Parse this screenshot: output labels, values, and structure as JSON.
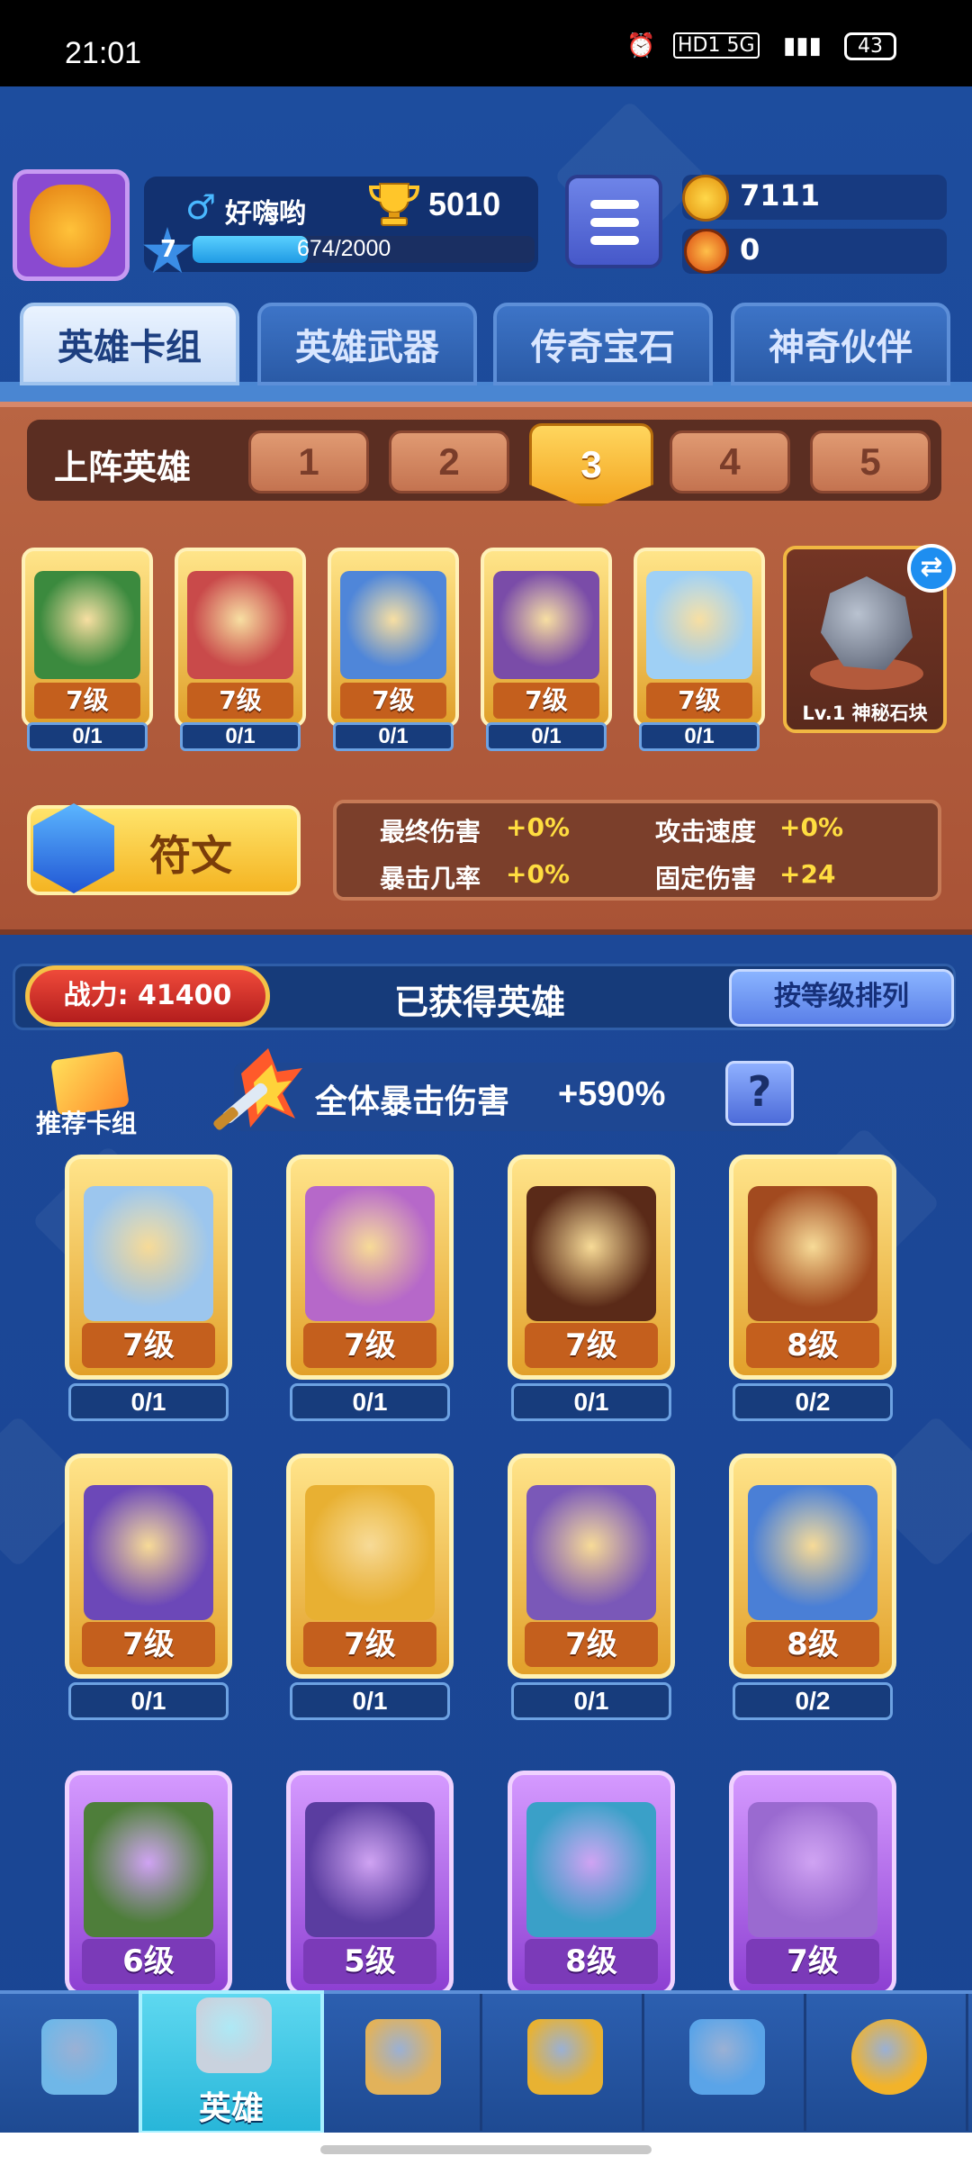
{
  "status_bar": {
    "time": "21:01",
    "network": "HD1 5G",
    "battery": "43"
  },
  "player": {
    "name": "好嗨哟",
    "trophies": "5010",
    "level": "7",
    "xp_text": "674/2000",
    "xp_fraction": 0.337
  },
  "currency": {
    "gold": "7111",
    "fire": "0"
  },
  "tabs": [
    {
      "label": "英雄卡组",
      "active": true
    },
    {
      "label": "英雄武器",
      "active": false
    },
    {
      "label": "传奇宝石",
      "active": false
    },
    {
      "label": "神奇伙伴",
      "active": false
    }
  ],
  "deck": {
    "label": "上阵英雄",
    "slots": [
      "1",
      "2",
      "3",
      "4",
      "5"
    ],
    "selected_slot": "3",
    "heroes": [
      {
        "level": "7级",
        "count": "0/1",
        "color": "#3b8a3e"
      },
      {
        "level": "7级",
        "count": "0/1",
        "color": "#c94a4a"
      },
      {
        "level": "7级",
        "count": "0/1",
        "color": "#4f86d9"
      },
      {
        "level": "7级",
        "count": "0/1",
        "color": "#7a4ca8"
      },
      {
        "level": "7级",
        "count": "0/1",
        "color": "#9fd0f5"
      }
    ],
    "partner": {
      "label": "Lv.1 神秘石块"
    }
  },
  "rune": {
    "label": "符文"
  },
  "stats": [
    {
      "name": "最终伤害",
      "value": "+0%"
    },
    {
      "name": "攻击速度",
      "value": "+0%"
    },
    {
      "name": "暴击几率",
      "value": "+0%"
    },
    {
      "name": "固定伤害",
      "value": "+24"
    }
  ],
  "collection": {
    "power": "战力: 41400",
    "title": "已获得英雄",
    "sort_button": "按等级排列",
    "recommend_label": "推荐卡组",
    "crit_label": "全体暴击伤害",
    "crit_value": "+590%",
    "help": "?"
  },
  "heroes": [
    {
      "level": "7级",
      "count": "0/1",
      "color": "#9cc6ee",
      "tier": "gold"
    },
    {
      "level": "7级",
      "count": "0/1",
      "color": "#b668c9",
      "tier": "gold"
    },
    {
      "level": "7级",
      "count": "0/1",
      "color": "#5a2a18",
      "tier": "gold"
    },
    {
      "level": "8级",
      "count": "0/2",
      "color": "#a24a1f",
      "tier": "gold"
    },
    {
      "level": "7级",
      "count": "0/1",
      "color": "#6c48b8",
      "tier": "gold"
    },
    {
      "level": "7级",
      "count": "0/1",
      "color": "#e8b032",
      "tier": "gold"
    },
    {
      "level": "7级",
      "count": "0/1",
      "color": "#7a58b8",
      "tier": "gold"
    },
    {
      "level": "8级",
      "count": "0/2",
      "color": "#4a7fd6",
      "tier": "gold"
    },
    {
      "level": "6级",
      "count": "",
      "color": "#4e7e3a",
      "tier": "purple"
    },
    {
      "level": "5级",
      "count": "",
      "color": "#5a3da0",
      "tier": "purple"
    },
    {
      "level": "8级",
      "count": "",
      "color": "#3aa0c8",
      "tier": "purple"
    },
    {
      "level": "7级",
      "count": "",
      "color": "#9a6ad0",
      "tier": "purple"
    }
  ],
  "nav": [
    {
      "icon": "treasure-chest-icon",
      "label": ""
    },
    {
      "icon": "knight-helmet-icon",
      "label": "英雄",
      "active": true
    },
    {
      "icon": "crossed-swords-icon",
      "label": ""
    },
    {
      "icon": "crown-shield-icon",
      "label": ""
    },
    {
      "icon": "guild-icon",
      "label": ""
    },
    {
      "icon": "compass-icon",
      "label": ""
    }
  ]
}
